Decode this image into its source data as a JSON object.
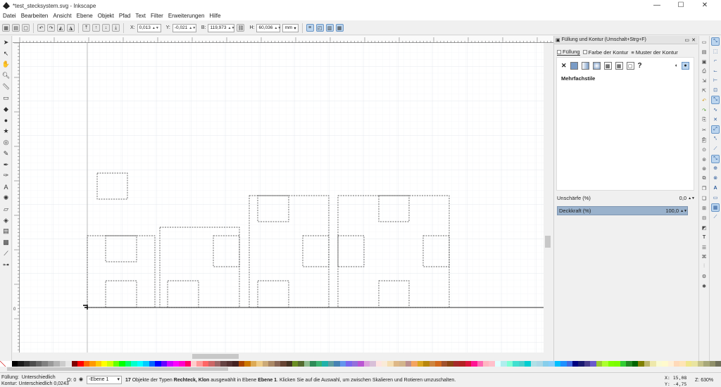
{
  "window": {
    "title": "*test_stecksystem.svg - Inkscape",
    "controls": [
      "—",
      "☐",
      "✕"
    ]
  },
  "menu": [
    "Datei",
    "Bearbeiten",
    "Ansicht",
    "Ebene",
    "Objekt",
    "Pfad",
    "Text",
    "Filter",
    "Erweiterungen",
    "Hilfe"
  ],
  "controls": {
    "x_label": "X:",
    "x_value": "0,013",
    "y_label": "Y:",
    "y_value": "-0,021",
    "w_label": "B:",
    "w_value": "119,973",
    "h_label": "H:",
    "h_value": "60,036",
    "unit": "mm"
  },
  "ruler": {
    "zero_label": "0"
  },
  "panel": {
    "title": "Füllung und Kontur (Umschalt+Strg+F)",
    "tabs": [
      "Füllung",
      "Farbe der Kontur",
      "Muster der Kontur"
    ],
    "paint_unknown": "?",
    "message": "Mehrfachstile",
    "blur_label": "Unschärfe (%)",
    "blur_value": "0,0",
    "opacity_label": "Deckkraft (%)",
    "opacity_value": "100,0"
  },
  "status": {
    "fill_label": "Füllung:",
    "fill_value": "Unterschiedlich",
    "stroke_label": "Kontur:",
    "stroke_value": "Unterschiedlich 0,0243",
    "opacity_short": "O:",
    "opacity_val": "0",
    "layer": "-Ebene 1",
    "msg_count": "17",
    "msg_a": " Objekte der Typen ",
    "msg_types": "Rechteck, Klon",
    "msg_b": " ausgewählt in Ebene ",
    "msg_layer": "Ebene 1",
    "msg_c": ". Klicken Sie auf die Auswahl, um zwischen Skalieren und Rotieren umzuschalten.",
    "x_label": "X:",
    "x_coord": "15,08",
    "y_label": "Y:",
    "y_coord": "-4,75",
    "zoom_label": "Z:",
    "zoom": "630%"
  },
  "palette_colors": [
    "#ffffff",
    "#000000",
    "#1a1a1a",
    "#333333",
    "#4d4d4d",
    "#666666",
    "#808080",
    "#999999",
    "#b3b3b3",
    "#cccccc",
    "#e6e6e6",
    "#800000",
    "#ff0000",
    "#ff6600",
    "#ff9900",
    "#ffcc00",
    "#ffff00",
    "#ccff00",
    "#66ff00",
    "#00ff00",
    "#00ff66",
    "#00ffcc",
    "#00ffff",
    "#00ccff",
    "#0066ff",
    "#0000ff",
    "#6600ff",
    "#cc00ff",
    "#ff00ff",
    "#ff00cc",
    "#ff0066",
    "#ffcccc",
    "#ff9999",
    "#ff6666",
    "#cc6666",
    "#996666",
    "#664444",
    "#553333",
    "#442222",
    "#aa4400",
    "#cc7700",
    "#ddaa55",
    "#eecc88",
    "#ccaa77",
    "#aa8866",
    "#886655",
    "#664433",
    "#443322",
    "#6b8e23",
    "#556b2f",
    "#8fbc8f",
    "#2e8b57",
    "#3cb371",
    "#20b2aa",
    "#5f9ea0",
    "#4682b4",
    "#6495ed",
    "#7b68ee",
    "#9370db",
    "#ba55d3",
    "#dda0dd",
    "#d8bfd8",
    "#ffe4e1",
    "#faebd7",
    "#f5deb3",
    "#deb887",
    "#d2b48c",
    "#bc8f8f",
    "#f4a460",
    "#daa520",
    "#b8860b",
    "#cd853f",
    "#d2691e",
    "#a0522d",
    "#8b4513",
    "#a52a2a",
    "#b22222",
    "#dc143c",
    "#ff1493",
    "#ff69b4",
    "#ffb6c1",
    "#ffc0cb",
    "#e0ffff",
    "#afeeee",
    "#7fffd4",
    "#40e0d0",
    "#48d1cc",
    "#00ced1",
    "#b0e0e6",
    "#add8e6",
    "#87ceeb",
    "#87cefa",
    "#00bfff",
    "#1e90ff",
    "#4169e1",
    "#000080",
    "#191970",
    "#483d8b",
    "#6a5acd",
    "#9acd32",
    "#adff2f",
    "#7fff00",
    "#7cfc00",
    "#32cd32",
    "#228b22",
    "#006400",
    "#808000",
    "#bdb76b",
    "#eee8aa",
    "#fafad2",
    "#fffacd",
    "#ffefd5",
    "#ffdab9",
    "#ffe4b5",
    "#f0e68c",
    "#e9e4a0",
    "#c5c28a",
    "#a8a87a",
    "#90906a",
    "#70705a"
  ]
}
